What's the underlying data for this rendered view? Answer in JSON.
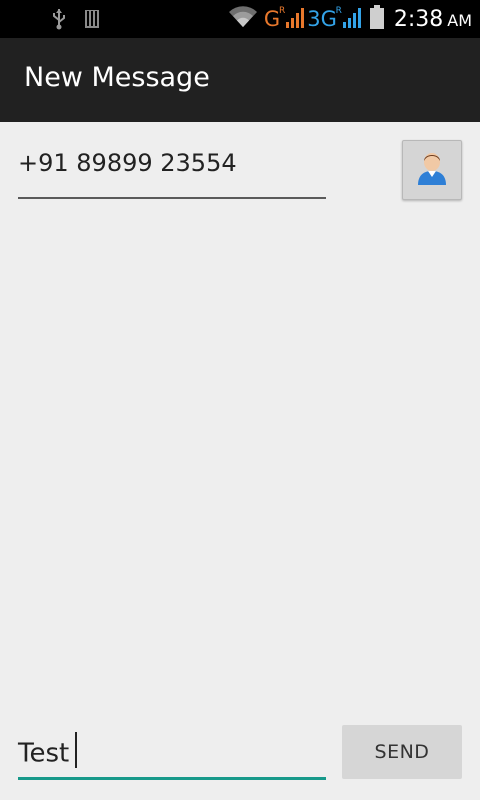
{
  "status_bar": {
    "network_g": "G",
    "network_g_roaming": "R",
    "network_3g": "3G",
    "network_3g_roaming": "R",
    "time": "2:38",
    "ampm": "AM",
    "icons": [
      "usb-icon",
      "sd-card-icon",
      "wifi-icon",
      "signal-bars-icon",
      "battery-icon"
    ]
  },
  "action_bar": {
    "title": "New Message"
  },
  "recipient": {
    "value": "+91 89899 23554",
    "contact_icon": "contact-person-icon"
  },
  "compose": {
    "value": "Test",
    "send_label": "SEND"
  },
  "colors": {
    "status_bar_bg": "#000000",
    "action_bar_bg": "#212121",
    "background": "#eeeeee",
    "accent_underline": "#17998a",
    "network_g": "#e8782c",
    "network_3g": "#33a3e8"
  }
}
